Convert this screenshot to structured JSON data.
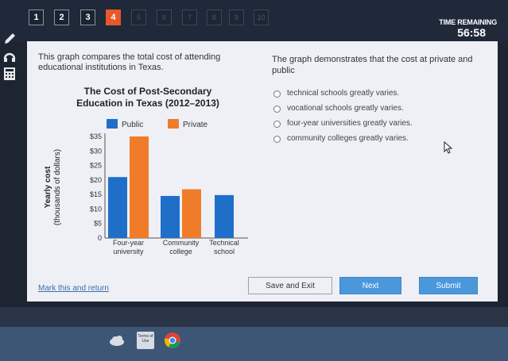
{
  "nav": {
    "questions": [
      "1",
      "2",
      "3",
      "4",
      "5",
      "6",
      "7",
      "8",
      "9",
      "10"
    ],
    "current": 4
  },
  "timer": {
    "label": "TIME REMAINING",
    "value": "56:58"
  },
  "prompt": "This graph compares the total cost of attending educational institutions in Texas.",
  "chart_data": {
    "type": "bar",
    "title": "The Cost of Post-Secondary Education in Texas (2012–2013)",
    "title_lines": [
      "The Cost of Post-Secondary",
      "Education in Texas (2012–2013)"
    ],
    "ylabel": "Yearly cost",
    "ylabel2": "(thousands of dollars)",
    "categories": [
      "Four-year university",
      "Community college",
      "Technical school"
    ],
    "category_lines": [
      [
        "Four-year",
        "university"
      ],
      [
        "Community",
        "college"
      ],
      [
        "Technical",
        "school"
      ]
    ],
    "yticks": [
      "0",
      "$5",
      "$10",
      "$15",
      "$20",
      "$25",
      "$30",
      "$35"
    ],
    "ylim": [
      0,
      35
    ],
    "series": [
      {
        "name": "Public",
        "color": "#1f6fc8",
        "values": [
          21,
          14.5,
          14.8
        ]
      },
      {
        "name": "Private",
        "color": "#f07c2a",
        "values": [
          35,
          16.8,
          null
        ]
      }
    ],
    "legend": "top"
  },
  "question": "The graph demonstrates that the cost at private and public",
  "options": [
    "technical schools greatly varies.",
    "vocational schools greatly varies.",
    "four-year universities greatly varies.",
    "community colleges greatly varies."
  ],
  "footer": {
    "mark_link": "Mark this and return",
    "save": "Save and Exit",
    "next": "Next",
    "submit": "Submit"
  },
  "taskbar": {
    "terms_text": "Terms of Use",
    "icons": [
      "cloud-icon",
      "terms-of-use-icon",
      "chrome-icon"
    ]
  }
}
